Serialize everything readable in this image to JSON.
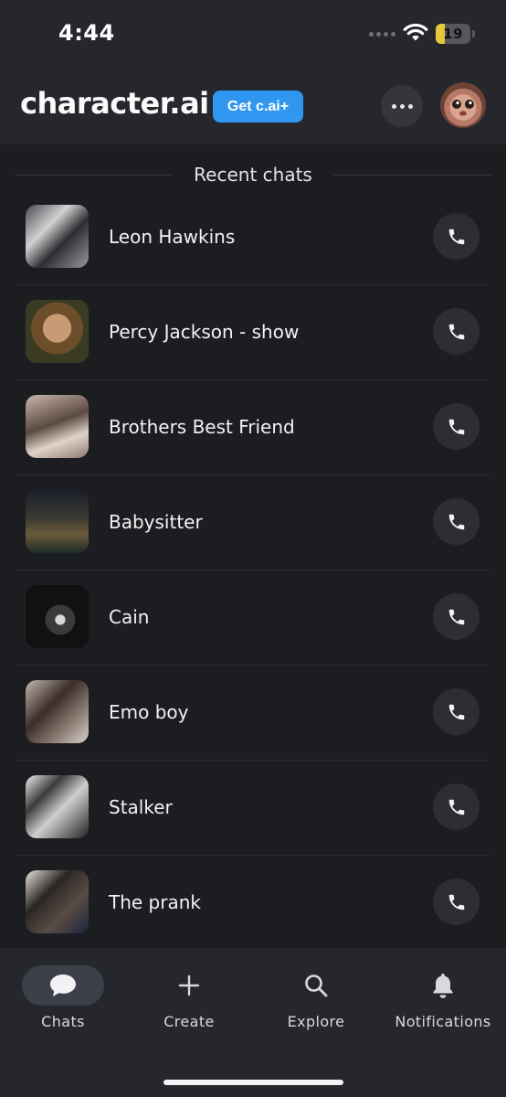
{
  "status_bar": {
    "time": "4:44",
    "battery": "19"
  },
  "header": {
    "brand": "character.ai",
    "upgrade_label": "Get c.ai+"
  },
  "section": {
    "title": "Recent chats"
  },
  "chats": [
    {
      "name": "Leon Hawkins"
    },
    {
      "name": "Percy Jackson - show"
    },
    {
      "name": "Brothers Best Friend"
    },
    {
      "name": "Babysitter"
    },
    {
      "name": "Cain"
    },
    {
      "name": "Emo boy"
    },
    {
      "name": "Stalker"
    },
    {
      "name": "The prank"
    }
  ],
  "nav": [
    {
      "label": "Chats",
      "icon": "chat-bubble-icon",
      "active": true
    },
    {
      "label": "Create",
      "icon": "plus-icon",
      "active": false
    },
    {
      "label": "Explore",
      "icon": "search-icon",
      "active": false
    },
    {
      "label": "Notifications",
      "icon": "bell-icon",
      "active": false
    }
  ],
  "colors": {
    "background": "#1c1d20",
    "header": "#25272c",
    "accent": "#2f97f0",
    "battery": "#e8c83a"
  }
}
